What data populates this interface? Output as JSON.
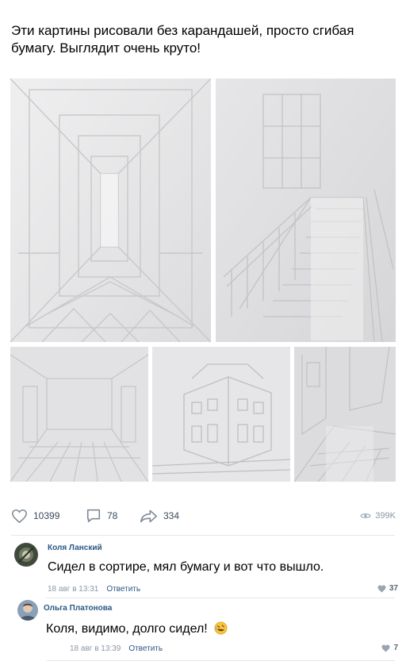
{
  "post": {
    "text": "Эти картины рисовали без карандашей, просто сгибая бумагу. Выглядит очень круто!"
  },
  "actions": {
    "likes": "10399",
    "comments": "78",
    "shares": "334",
    "views": "399K"
  },
  "comments": [
    {
      "author": "Коля Ланский",
      "text": "Сидел в сортире, мял бумагу и вот что вышло.",
      "date": "18 авг в 13:31",
      "reply_label": "Ответить",
      "likes": "37"
    },
    {
      "author": "Ольга Платонова",
      "text": "Коля, видимо, долго сидел!",
      "date": "18 авг в 13:39",
      "reply_label": "Ответить",
      "likes": "7"
    }
  ],
  "icons": {
    "like": "heart-icon",
    "comment": "comment-bubble-icon",
    "share": "share-arrow-icon",
    "views": "eye-icon",
    "emoji": "rofl-emoji"
  },
  "colors": {
    "link": "#2a5885",
    "meta": "#8c97a3",
    "action": "#3a4a5c",
    "paper": "#e9e9ea"
  }
}
